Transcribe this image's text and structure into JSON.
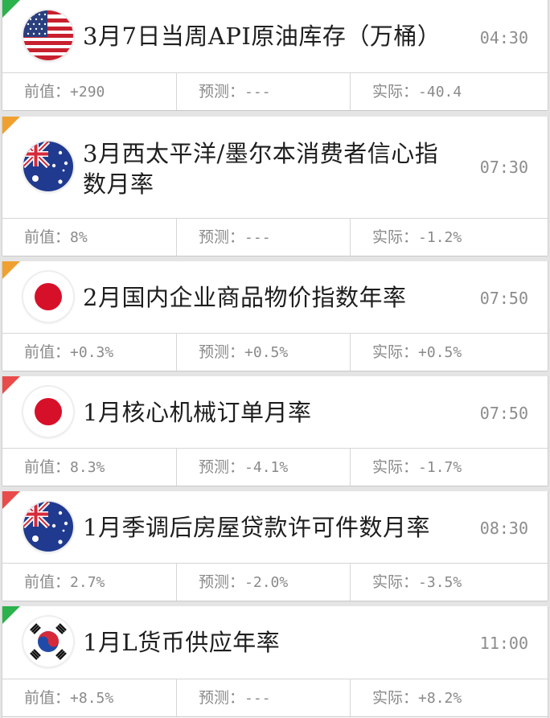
{
  "labels": {
    "prev": "前值：",
    "forecast": "预测：",
    "actual": "实际："
  },
  "colors": {
    "green": "#2bb24c",
    "orange": "#f0a030",
    "red": "#e94b4b"
  },
  "events": [
    {
      "country": "us-flag-icon",
      "title": "3月7日当周API原油库存（万桶）",
      "time": "04:30",
      "prev": "+290",
      "forecast": "---",
      "actual": "-40.4",
      "importance": "green"
    },
    {
      "country": "au-flag-icon",
      "title": "3月西太平洋/墨尔本消费者信心指数月率",
      "time": "07:30",
      "prev": "8%",
      "forecast": "---",
      "actual": "-1.2%",
      "importance": "orange"
    },
    {
      "country": "jp-flag-icon",
      "title": "2月国内企业商品物价指数年率",
      "time": "07:50",
      "prev": "+0.3%",
      "forecast": "+0.5%",
      "actual": "+0.5%",
      "importance": "orange"
    },
    {
      "country": "jp-flag-icon",
      "title": "1月核心机械订单月率",
      "time": "07:50",
      "prev": "8.3%",
      "forecast": "-4.1%",
      "actual": "-1.7%",
      "importance": "red"
    },
    {
      "country": "au-flag-icon",
      "title": "1月季调后房屋贷款许可件数月率",
      "time": "08:30",
      "prev": "2.7%",
      "forecast": "-2.0%",
      "actual": "-3.5%",
      "importance": "red"
    },
    {
      "country": "kr-flag-icon",
      "title": "1月L货币供应年率",
      "time": "11:00",
      "prev": "+8.5%",
      "forecast": "---",
      "actual": "+8.2%",
      "importance": "green"
    }
  ]
}
